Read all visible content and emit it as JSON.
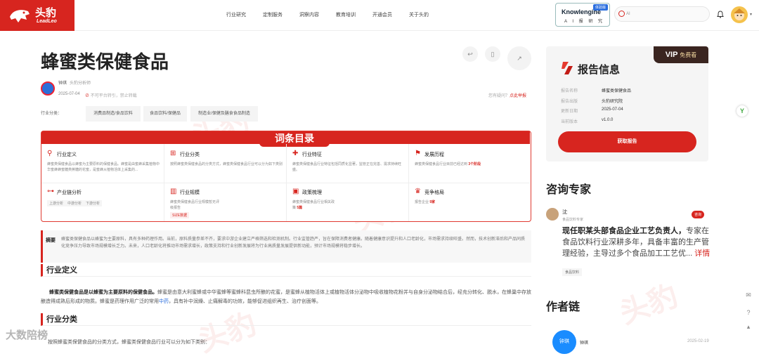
{
  "header": {
    "logo_cn": "头豹",
    "logo_en": "LeadLeo",
    "nav": [
      "行业研究",
      "定制服务",
      "洞察内容",
      "教育培训",
      "开通会员",
      "关于头豹"
    ],
    "knowlengine": {
      "name": "Knowlengine",
      "sub": "A I 报 研 究",
      "badge": "体验版"
    },
    "search_placeholder": "AI"
  },
  "article": {
    "title": "蜂蜜类保健食品",
    "author": "钟琪",
    "author_org": "头豹分析师",
    "date": "2025-07-04",
    "restriction": "不可平台转引，禁止转载",
    "report_prompt": "您有疑问？",
    "report_link": "点此举报",
    "industry_label": "行业分类：",
    "tags": [
      "消费品制造/食品饮料",
      "食品饮料/保健品",
      "制造业/保健及膳食食品制造"
    ],
    "directory_title": "词条目录",
    "cells": [
      {
        "icon": "⚲",
        "title": "行业定义",
        "desc": "蜂蜜类保健食品以蜂蜜为主要原料的保健食品。蜂蜜是由蜜蜂采集植物中华蜜蜂蜂蜜糖类蔗糖的花蜜，是蜜蜂从植物活体上采集的..."
      },
      {
        "icon": "⊞",
        "title": "行业分类",
        "desc": "按照蜂蜜类保健食品的分类方式，蜂蜜类保健食品行业可以分为如下类别"
      },
      {
        "icon": "✚",
        "title": "行业特征",
        "desc": "蜂蜜类保健食品行业特征包括同质化显著，监管正在完善、需求持续旺盛。"
      },
      {
        "icon": "⚑",
        "title": "发展历程",
        "desc": "蜂蜜类保健食品行业目前已经达到 ",
        "desc_strong": "3个阶段"
      },
      {
        "icon": "⊶",
        "title": "产业链分析",
        "pills": [
          "上游分析",
          "中游分析",
          "下游分析"
        ]
      },
      {
        "icon": "▥",
        "title": "行业规模",
        "desc": "蜂蜜类保健食品行业规模暂无评级报告",
        "link": "SIZE数据"
      },
      {
        "icon": "▣",
        "title": "政策梳理",
        "desc": "蜂蜜类保健食品行业相关政策 ",
        "desc_strong": "5篇"
      },
      {
        "icon": "♛",
        "title": "竞争格局",
        "desc": "报告企业 ",
        "desc_strong": "9家"
      }
    ],
    "summary_label": "摘要",
    "summary": "蜂蜜类保健食品以蜂蜜为主要原料，具有多种药理作用。当前，原料质量参差不齐，要求中游企业建立严格筛选和检测机制。行业监管趋严，旨在保障消费者健康。随着健康意识提升和人口老龄化，市场需求持续旺盛。然而，技术创新滞后和产品同质化竞争压力导致市场规模增长乏力。未来，人口老龄化将推动市场需求增长，政策支持和行业创新发展将为行业高质量发展提供新动能，预计市场规模将稳步增长。",
    "def_heading": "行业定义",
    "def_text_strong": "蜂蜜类保健食品是以蜂蜜为主要原料的保健食品。",
    "def_text": "蜂蜜是由意大利蜜蜂或中华蜜蜂等蜜蜂科昆虫所酿的花蜜，是蜜蜂从植物活体上或植物活体分泌物中吸收植物花粉并与自身分泌物结合后，经充分转化、脱水，在蜂巢中存放酿造得成熟后形成的物质。蜂蜜是药理作用广泛的常用",
    "def_text_link": "中药",
    "def_text_tail": "，具有补中润燥、止痛解毒的功效，能够促进组织再生、治疗创面等。",
    "cls_heading": "行业分类",
    "cls_text": "按照蜂蜜类保健食品的分类方式，蜂蜜类保健食品行业可以分为如下类别："
  },
  "report_info": {
    "vip": "VIP",
    "vip_sub": "免费看",
    "title": "报告信息",
    "rows": [
      {
        "k": "报告名称",
        "v": "蜂蜜类保健食品"
      },
      {
        "k": "报告出版",
        "v": "头豹研究院"
      },
      {
        "k": "更新日期",
        "v": "2025-07-04"
      },
      {
        "k": "当前版本",
        "v": "v1.0.0"
      }
    ],
    "button": "获取报告"
  },
  "expert": {
    "heading": "咨询专家",
    "name": "沈",
    "sub": "食品饮料专家",
    "badge": "咨询",
    "desc_strong": "现任职某头部食品企业工艺负责人，",
    "desc": "专家在食品饮料行业深耕多年，具备丰富的生产管理经验，主导过多个食品加工工艺优...",
    "more": "详情",
    "tag": "食品饮料"
  },
  "chain": {
    "heading": "作者链",
    "avatar_text": "钟琪",
    "name": "钟琪",
    "date": "2025-02-19"
  },
  "watermark": "大数陪榜",
  "wm_logo": "头豹"
}
